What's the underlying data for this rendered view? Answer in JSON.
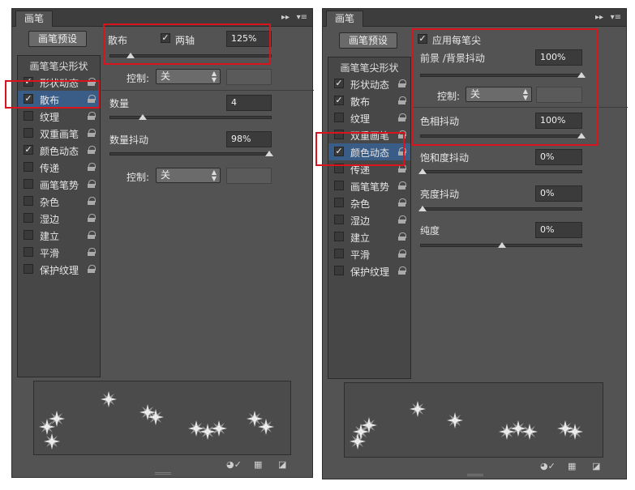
{
  "left_panel": {
    "tab_label": "画笔",
    "preset_button": "画笔预设",
    "list_header": "画笔笔尖形状",
    "items": [
      {
        "label": "形状动态",
        "checked": true
      },
      {
        "label": "散布",
        "checked": true,
        "selected": true
      },
      {
        "label": "纹理",
        "checked": false
      },
      {
        "label": "双重画笔",
        "checked": false
      },
      {
        "label": "颜色动态",
        "checked": true
      },
      {
        "label": "传递",
        "checked": false
      },
      {
        "label": "画笔笔势",
        "checked": false
      },
      {
        "label": "杂色",
        "checked": false
      },
      {
        "label": "湿边",
        "checked": false
      },
      {
        "label": "建立",
        "checked": false
      },
      {
        "label": "平滑",
        "checked": false
      },
      {
        "label": "保护纹理",
        "checked": false
      }
    ],
    "scatter_label": "散布",
    "both_axes_label": "两轴",
    "scatter_value": "125%",
    "control1_label": "控制:",
    "control1_value": "关",
    "count_label": "数量",
    "count_value": "4",
    "count_jitter_label": "数量抖动",
    "count_jitter_value": "98%",
    "control2_label": "控制:",
    "control2_value": "关"
  },
  "right_panel": {
    "tab_label": "画笔",
    "preset_button": "画笔预设",
    "list_header": "画笔笔尖形状",
    "items": [
      {
        "label": "形状动态",
        "checked": true
      },
      {
        "label": "散布",
        "checked": true
      },
      {
        "label": "纹理",
        "checked": false
      },
      {
        "label": "双重画笔",
        "checked": false
      },
      {
        "label": "颜色动态",
        "checked": true,
        "selected": true
      },
      {
        "label": "传递",
        "checked": false
      },
      {
        "label": "画笔笔势",
        "checked": false
      },
      {
        "label": "杂色",
        "checked": false
      },
      {
        "label": "湿边",
        "checked": false
      },
      {
        "label": "建立",
        "checked": false
      },
      {
        "label": "平滑",
        "checked": false
      },
      {
        "label": "保护纹理",
        "checked": false
      }
    ],
    "apply_per_tip_label": "应用每笔尖",
    "fg_bg_jitter_label": "前景 /背景抖动",
    "fg_bg_jitter_value": "100%",
    "control_label": "控制:",
    "control_value": "关",
    "hue_jitter_label": "色相抖动",
    "hue_jitter_value": "100%",
    "saturation_jitter_label": "饱和度抖动",
    "saturation_jitter_value": "0%",
    "brightness_jitter_label": "亮度抖动",
    "brightness_jitter_value": "0%",
    "purity_label": "纯度",
    "purity_value": "0%"
  },
  "colors": {
    "panel_bg": "#535353",
    "highlight_red": "#d9141c",
    "selection_blue": "#3a5d88"
  }
}
